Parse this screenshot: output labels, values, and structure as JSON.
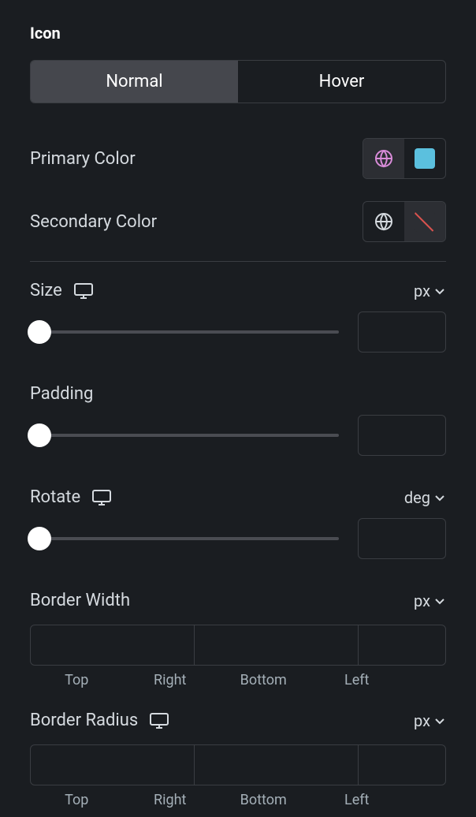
{
  "section": {
    "title": "Icon"
  },
  "tabs": {
    "normal": "Normal",
    "hover": "Hover"
  },
  "primaryColor": {
    "label": "Primary Color",
    "swatch": "#5bc0de"
  },
  "secondaryColor": {
    "label": "Secondary Color"
  },
  "size": {
    "label": "Size",
    "unit": "px",
    "value": ""
  },
  "padding": {
    "label": "Padding",
    "value": ""
  },
  "rotate": {
    "label": "Rotate",
    "unit": "deg",
    "value": ""
  },
  "borderWidth": {
    "label": "Border Width",
    "unit": "px",
    "sides": {
      "top": "Top",
      "right": "Right",
      "bottom": "Bottom",
      "left": "Left"
    }
  },
  "borderRadius": {
    "label": "Border Radius",
    "unit": "px",
    "sides": {
      "top": "Top",
      "right": "Right",
      "bottom": "Bottom",
      "left": "Left"
    }
  }
}
